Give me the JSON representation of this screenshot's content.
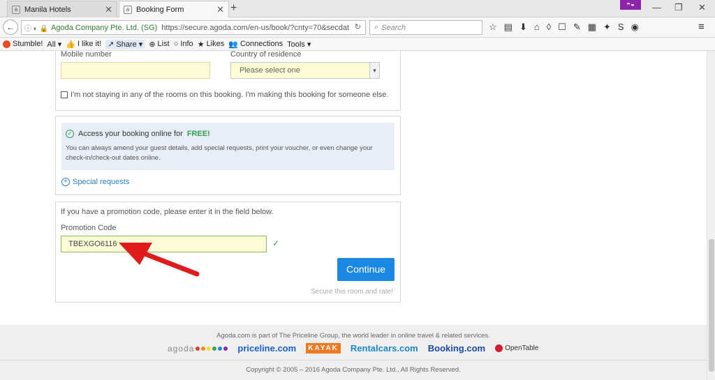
{
  "browser": {
    "tabs": [
      {
        "title": "Manila Hotels",
        "favicon": "a"
      },
      {
        "title": "Booking Form",
        "favicon": "a"
      }
    ],
    "new_tab_icon": "+",
    "mask_icon": "mask-icon",
    "url_owner": "Agoda Company Pte. Ltd. (SG)",
    "url": "https://secure.agoda.com/en-us/book/?cnty=70&secdat",
    "search_placeholder": "Search",
    "bookmarks": [
      {
        "label": "Stumble!"
      },
      {
        "label": "All ▾"
      },
      {
        "label": "I like it!"
      },
      {
        "label": "Share ▾"
      },
      {
        "label": "List"
      },
      {
        "label": "Info"
      },
      {
        "label": "Likes"
      },
      {
        "label": "Connections"
      },
      {
        "label": "Tools ▾"
      }
    ]
  },
  "form": {
    "mobile_label": "Mobile number",
    "mobile_value": "",
    "country_label": "Country of residence",
    "country_value": "Please select one",
    "not_staying_text": "I'm not staying in any of the rooms on this booking. I'm making this booking for someone else.",
    "access_text": "Access your booking online for",
    "access_free": "FREE!",
    "access_desc": "You can always amend your guest details, add special requests, print your voucher, or even change your check-in/check-out dates online.",
    "special_requests": "Special requests",
    "promo_intro": "If you have a promotion code, please enter it in the field below.",
    "promo_label": "Promotion Code",
    "promo_value": "TBEXGO6116",
    "continue_label": "Continue",
    "secure_text": "Secure this room and rate!"
  },
  "footer": {
    "tagline": "Agoda.com is part of The Priceline Group, the world leader in online travel & related services.",
    "brands": [
      "agoda",
      "priceline.com",
      "KAYAK",
      "Rentalcars.com",
      "Booking.com",
      "OpenTable"
    ],
    "copyright": "Copyright © 2005 – 2016 Agoda Company Pte. Ltd., All Rights Reserved."
  },
  "colors": {
    "accent": "#1b88e3",
    "annotation_arrow": "#e01b1b",
    "success": "#2e9e4f"
  }
}
